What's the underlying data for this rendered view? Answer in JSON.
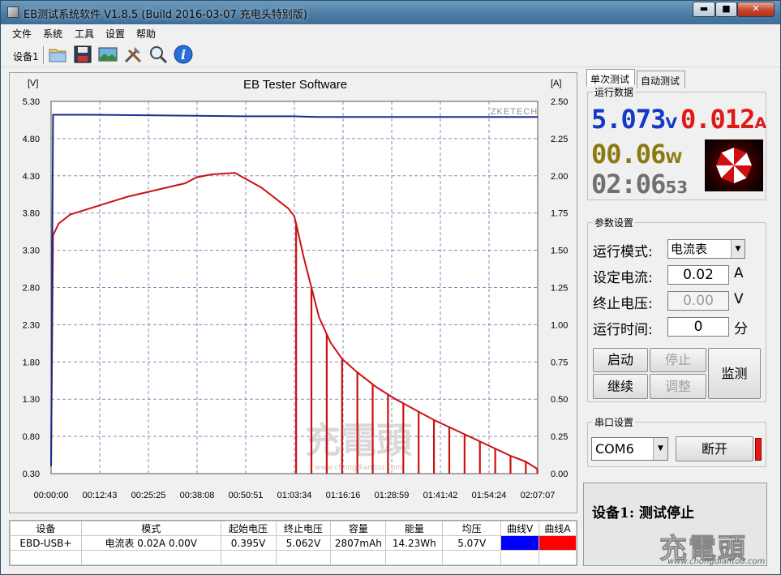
{
  "window": {
    "title": "EB测试系统软件 V1.8.5 (Build 2016-03-07 充电头特别版)",
    "minimize": "▬",
    "maximize": "■",
    "close": "✕"
  },
  "menu": [
    "文件",
    "系统",
    "工具",
    "设置",
    "帮助"
  ],
  "toolbar": {
    "device_label": "设备1",
    "icons": [
      "folder-icon",
      "save-icon",
      "image-icon",
      "tools-icon",
      "zoom-icon",
      "info-icon"
    ]
  },
  "chart_data": {
    "type": "line",
    "title": "EB Tester Software",
    "watermark": "ZKETECH",
    "left_unit": "[V]",
    "right_unit": "[A]",
    "y_left_ticks": [
      "5.30",
      "4.80",
      "4.30",
      "3.80",
      "3.30",
      "2.80",
      "2.30",
      "1.80",
      "1.30",
      "0.80",
      "0.30"
    ],
    "y_right_ticks": [
      "2.50",
      "2.25",
      "2.00",
      "1.75",
      "1.50",
      "1.25",
      "1.00",
      "0.75",
      "0.50",
      "0.25",
      "0.00"
    ],
    "x_ticks": [
      "00:00:00",
      "00:12:43",
      "00:25:25",
      "00:38:08",
      "00:50:51",
      "01:03:34",
      "01:16:16",
      "01:28:59",
      "01:41:42",
      "01:54:24",
      "02:07:07"
    ],
    "y_left_range": [
      0.3,
      5.3
    ],
    "y_right_range": [
      0,
      2.5
    ],
    "x_range_min": [
      0,
      127.1
    ],
    "series": [
      {
        "axis": "left",
        "color": "#1a2e8c",
        "x": [
          0,
          0.5,
          1,
          10,
          30,
          50,
          63,
          70,
          80,
          100,
          127.1
        ],
        "y": [
          0.4,
          5.12,
          5.12,
          5.12,
          5.11,
          5.1,
          5.1,
          5.09,
          5.09,
          5.09,
          5.09
        ]
      },
      {
        "axis": "right",
        "color": "#cc1111",
        "x": [
          0,
          0.5,
          2,
          5,
          10,
          15,
          20,
          25,
          30,
          35,
          38,
          42,
          48,
          55,
          62,
          63.5,
          64,
          66,
          68,
          70,
          73,
          76,
          80,
          85,
          90,
          95,
          100,
          105,
          110,
          115,
          120,
          124,
          127.1
        ],
        "y": [
          0.05,
          1.6,
          1.68,
          1.74,
          1.78,
          1.82,
          1.86,
          1.89,
          1.92,
          1.95,
          1.99,
          2.01,
          2.02,
          1.92,
          1.78,
          1.73,
          1.68,
          1.45,
          1.25,
          1.05,
          0.88,
          0.77,
          0.68,
          0.58,
          0.5,
          0.43,
          0.36,
          0.3,
          0.24,
          0.18,
          0.12,
          0.08,
          0.03
        ]
      }
    ],
    "red_spikes_x": [
      64,
      68,
      72,
      76,
      80,
      84,
      88,
      92,
      96,
      100,
      104,
      108,
      112,
      116,
      120,
      124,
      127
    ],
    "center_watermark": "充電頭",
    "center_watermark_url": "www.chongdiantou.com"
  },
  "table": {
    "headers": [
      "设备",
      "模式",
      "起始电压",
      "终止电压",
      "容量",
      "能量",
      "均压",
      "曲线V",
      "曲线A"
    ],
    "row": [
      "EBD-USB+",
      "电流表  0.02A  0.00V",
      "0.395V",
      "5.062V",
      "2807mAh",
      "14.23Wh",
      "5.07V",
      "",
      ""
    ],
    "curve_v_color": "#0000ff",
    "curve_a_color": "#ff0000"
  },
  "right": {
    "tabs": [
      "单次测试",
      "自动测试"
    ],
    "data_title": "运行数据",
    "voltage": "5.073",
    "voltage_unit": "V",
    "current": "0.012",
    "current_unit": "A",
    "power": "00.06",
    "power_unit": "W",
    "time": "02:06",
    "time_seconds": "53",
    "params_title": "参数设置",
    "mode_label": "运行模式:",
    "mode_value": "电流表",
    "set_current_label": "设定电流:",
    "set_current_value": "0.02",
    "set_current_unit": "A",
    "stop_voltage_label": "终止电压:",
    "stop_voltage_value": "0.00",
    "stop_voltage_unit": "V",
    "run_time_label": "运行时间:",
    "run_time_value": "0",
    "run_time_unit": "分",
    "btn_start": "启动",
    "btn_stop": "停止",
    "btn_monitor": "监测",
    "btn_continue": "继续",
    "btn_adjust": "调整",
    "port_title": "串口设置",
    "port_value": "COM6",
    "btn_disconnect": "断开",
    "status": "设备1: 测试停止"
  },
  "watermark_corner": "充電頭",
  "watermark_corner_url": "www.chongdiantou.com"
}
